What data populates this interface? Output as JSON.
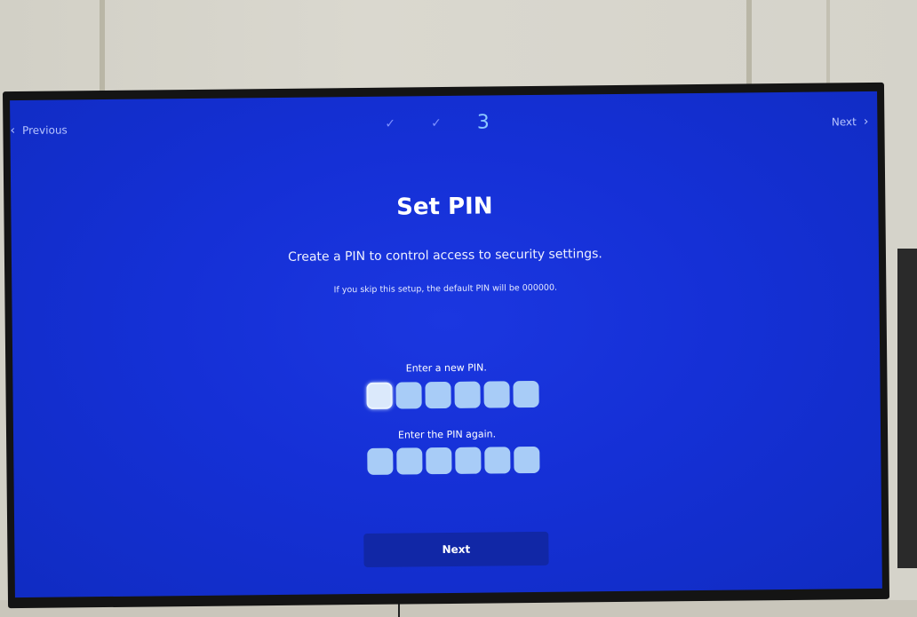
{
  "nav": {
    "previous_label": "Previous",
    "next_label": "Next"
  },
  "steps": {
    "current": "3"
  },
  "page": {
    "title": "Set PIN",
    "subtitle": "Create a PIN to control access to security settings.",
    "hint": "If you skip this setup, the default PIN will be 000000."
  },
  "pin": {
    "new_label": "Enter a new PIN.",
    "confirm_label": "Enter the PIN again.",
    "digits": 6
  },
  "buttons": {
    "next_label": "Next"
  },
  "colors": {
    "screen_blue": "#1530d6",
    "pin_box": "#a8ccf7",
    "pin_focused": "#dbe9fb",
    "button_bg": "#1127a6",
    "step_current": "#8cc8ff"
  }
}
